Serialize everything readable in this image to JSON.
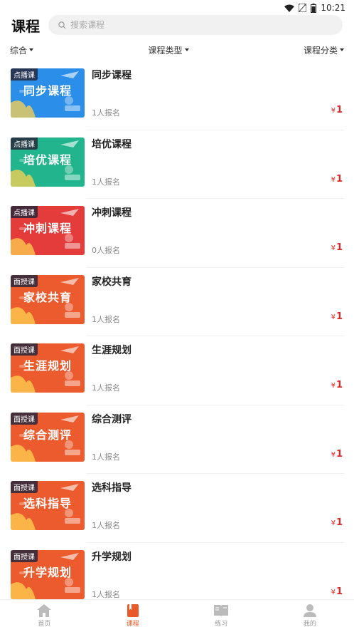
{
  "status": {
    "time": "10:21"
  },
  "header": {
    "title": "课程",
    "search_placeholder": "搜索课程"
  },
  "filters": [
    {
      "label": "综合"
    },
    {
      "label": "课程类型"
    },
    {
      "label": "课程分类"
    }
  ],
  "courses": [
    {
      "tag": "点播课",
      "thumb_title": "同步课程",
      "title": "同步课程",
      "enroll": "1人报名",
      "currency": "¥",
      "price": "1",
      "theme": "#2b8ee8"
    },
    {
      "tag": "点播课",
      "thumb_title": "培优课程",
      "title": "培优课程",
      "enroll": "1人报名",
      "currency": "¥",
      "price": "1",
      "theme": "#22b48c"
    },
    {
      "tag": "点播课",
      "thumb_title": "冲刺课程",
      "title": "冲刺课程",
      "enroll": "0人报名",
      "currency": "¥",
      "price": "1",
      "theme": "#e43b3b"
    },
    {
      "tag": "面授课",
      "thumb_title": "家校共育",
      "title": "家校共育",
      "enroll": "1人报名",
      "currency": "¥",
      "price": "1",
      "theme": "#ec5b2e"
    },
    {
      "tag": "面授课",
      "thumb_title": "生涯规划",
      "title": "生涯规划",
      "enroll": "1人报名",
      "currency": "¥",
      "price": "1",
      "theme": "#ec5b2e"
    },
    {
      "tag": "面授课",
      "thumb_title": "综合测评",
      "title": "综合测评",
      "enroll": "1人报名",
      "currency": "¥",
      "price": "1",
      "theme": "#ec5b2e"
    },
    {
      "tag": "面授课",
      "thumb_title": "选科指导",
      "title": "选科指导",
      "enroll": "1人报名",
      "currency": "¥",
      "price": "1",
      "theme": "#ec5b2e"
    },
    {
      "tag": "面授课",
      "thumb_title": "升学规划",
      "title": "升学规划",
      "enroll": "1人报名",
      "currency": "¥",
      "price": "1",
      "theme": "#ec5b2e"
    }
  ],
  "tabs": [
    {
      "label": "首页",
      "icon": "home-icon"
    },
    {
      "label": "课程",
      "icon": "book-icon",
      "active": true
    },
    {
      "label": "练习",
      "icon": "open-book-icon"
    },
    {
      "label": "我的",
      "icon": "user-icon"
    }
  ],
  "colors": {
    "accent": "#e95a2b",
    "price": "#e02626"
  }
}
